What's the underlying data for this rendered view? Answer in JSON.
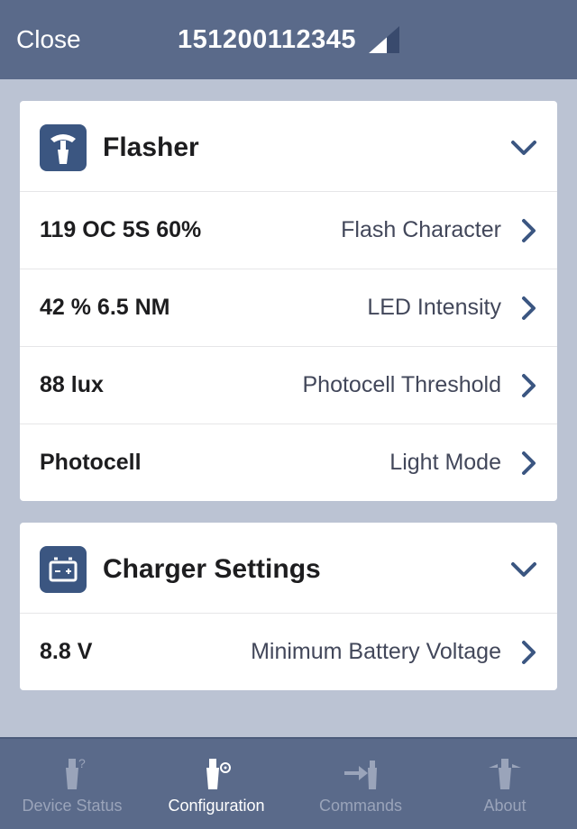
{
  "header": {
    "close_label": "Close",
    "title": "151200112345"
  },
  "sections": {
    "flasher": {
      "title": "Flasher",
      "rows": [
        {
          "value": "119 OC 5S 60%",
          "label": "Flash Character"
        },
        {
          "value": "42 % 6.5 NM",
          "label": "LED Intensity"
        },
        {
          "value": "88 lux",
          "label": "Photocell Threshold"
        },
        {
          "value": "Photocell",
          "label": "Light Mode"
        }
      ]
    },
    "charger": {
      "title": "Charger Settings",
      "rows": [
        {
          "value": "8.8 V",
          "label": "Minimum Battery Voltage"
        }
      ]
    }
  },
  "tabbar": {
    "items": [
      {
        "label": "Device Status",
        "active": false
      },
      {
        "label": "Configuration",
        "active": true
      },
      {
        "label": "Commands",
        "active": false
      },
      {
        "label": "About",
        "active": false
      }
    ]
  }
}
